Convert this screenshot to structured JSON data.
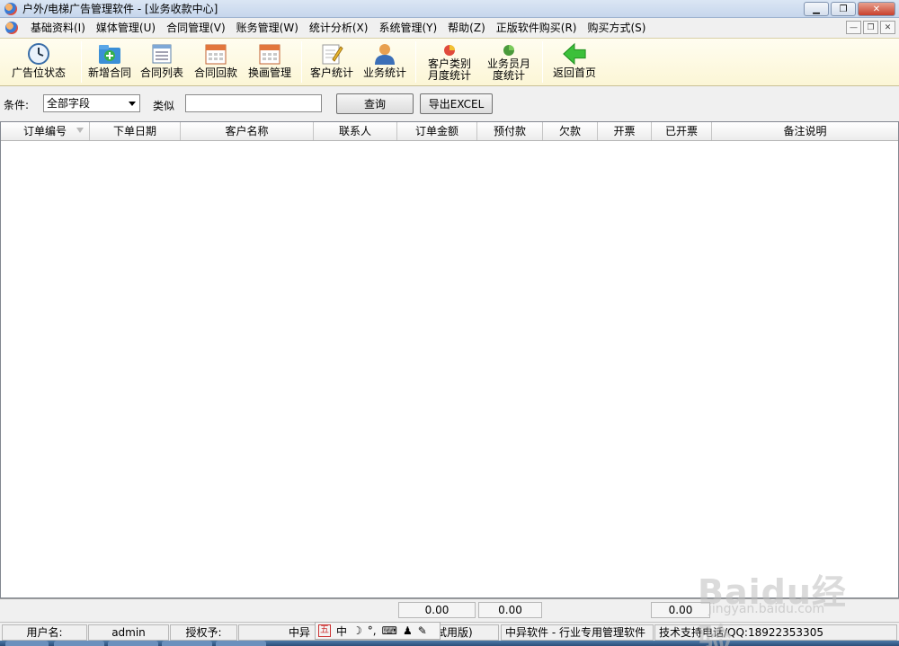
{
  "window": {
    "title": "户外/电梯广告管理软件 - [业务收款中心]"
  },
  "menu": [
    "基础资料(I)",
    "媒体管理(U)",
    "合同管理(V)",
    "账务管理(W)",
    "统计分析(X)",
    "系统管理(Y)",
    "帮助(Z)",
    "正版软件购买(R)",
    "购买方式(S)"
  ],
  "toolbar": [
    {
      "label": "广告位状态",
      "icon": "clock-icon"
    },
    {
      "label": "新增合同",
      "icon": "new-contract-icon"
    },
    {
      "label": "合同列表",
      "icon": "list-icon"
    },
    {
      "label": "合同回款",
      "icon": "calendar-icon"
    },
    {
      "label": "换画管理",
      "icon": "calendar-icon"
    },
    {
      "label": "客户统计",
      "icon": "notepad-icon"
    },
    {
      "label": "业务统计",
      "icon": "user-icon"
    },
    {
      "label": "客户类别\n月度统计",
      "icon": "pie-chart-icon"
    },
    {
      "label": "业务员月\n度统计",
      "icon": "pie-chart-icon"
    },
    {
      "label": "返回首页",
      "icon": "back-arrow-icon"
    }
  ],
  "filter": {
    "condition_label": "条件:",
    "field_value": "全部字段",
    "like_label": "类似",
    "search_value": "",
    "query_label": "查询",
    "export_label": "导出EXCEL"
  },
  "columns": [
    "订单编号",
    "下单日期",
    "客户名称",
    "联系人",
    "订单金额",
    "预付款",
    "欠款",
    "开票",
    "已开票",
    "备注说明"
  ],
  "totals": {
    "order_amount": "0.00",
    "prepaid": "0.00",
    "invoiced": "0.00"
  },
  "status": {
    "user_label": "用户名:",
    "user_value": "admin",
    "license_label": "授权予:",
    "license_value": "中异",
    "edition": "试用版)",
    "company": "中异软件 - 行业专用管理软件",
    "support": "技术支持电话/QQ:18922353305"
  },
  "ime": {
    "box": "五",
    "mode": "中"
  },
  "watermark": {
    "main": "Baidu经验",
    "sub": "jingyan.baidu.com"
  },
  "colors": {
    "toolbar_bg": "#fcf6d6",
    "grid_bg": "#ffffff",
    "titlebar": "#c6d6ec"
  }
}
